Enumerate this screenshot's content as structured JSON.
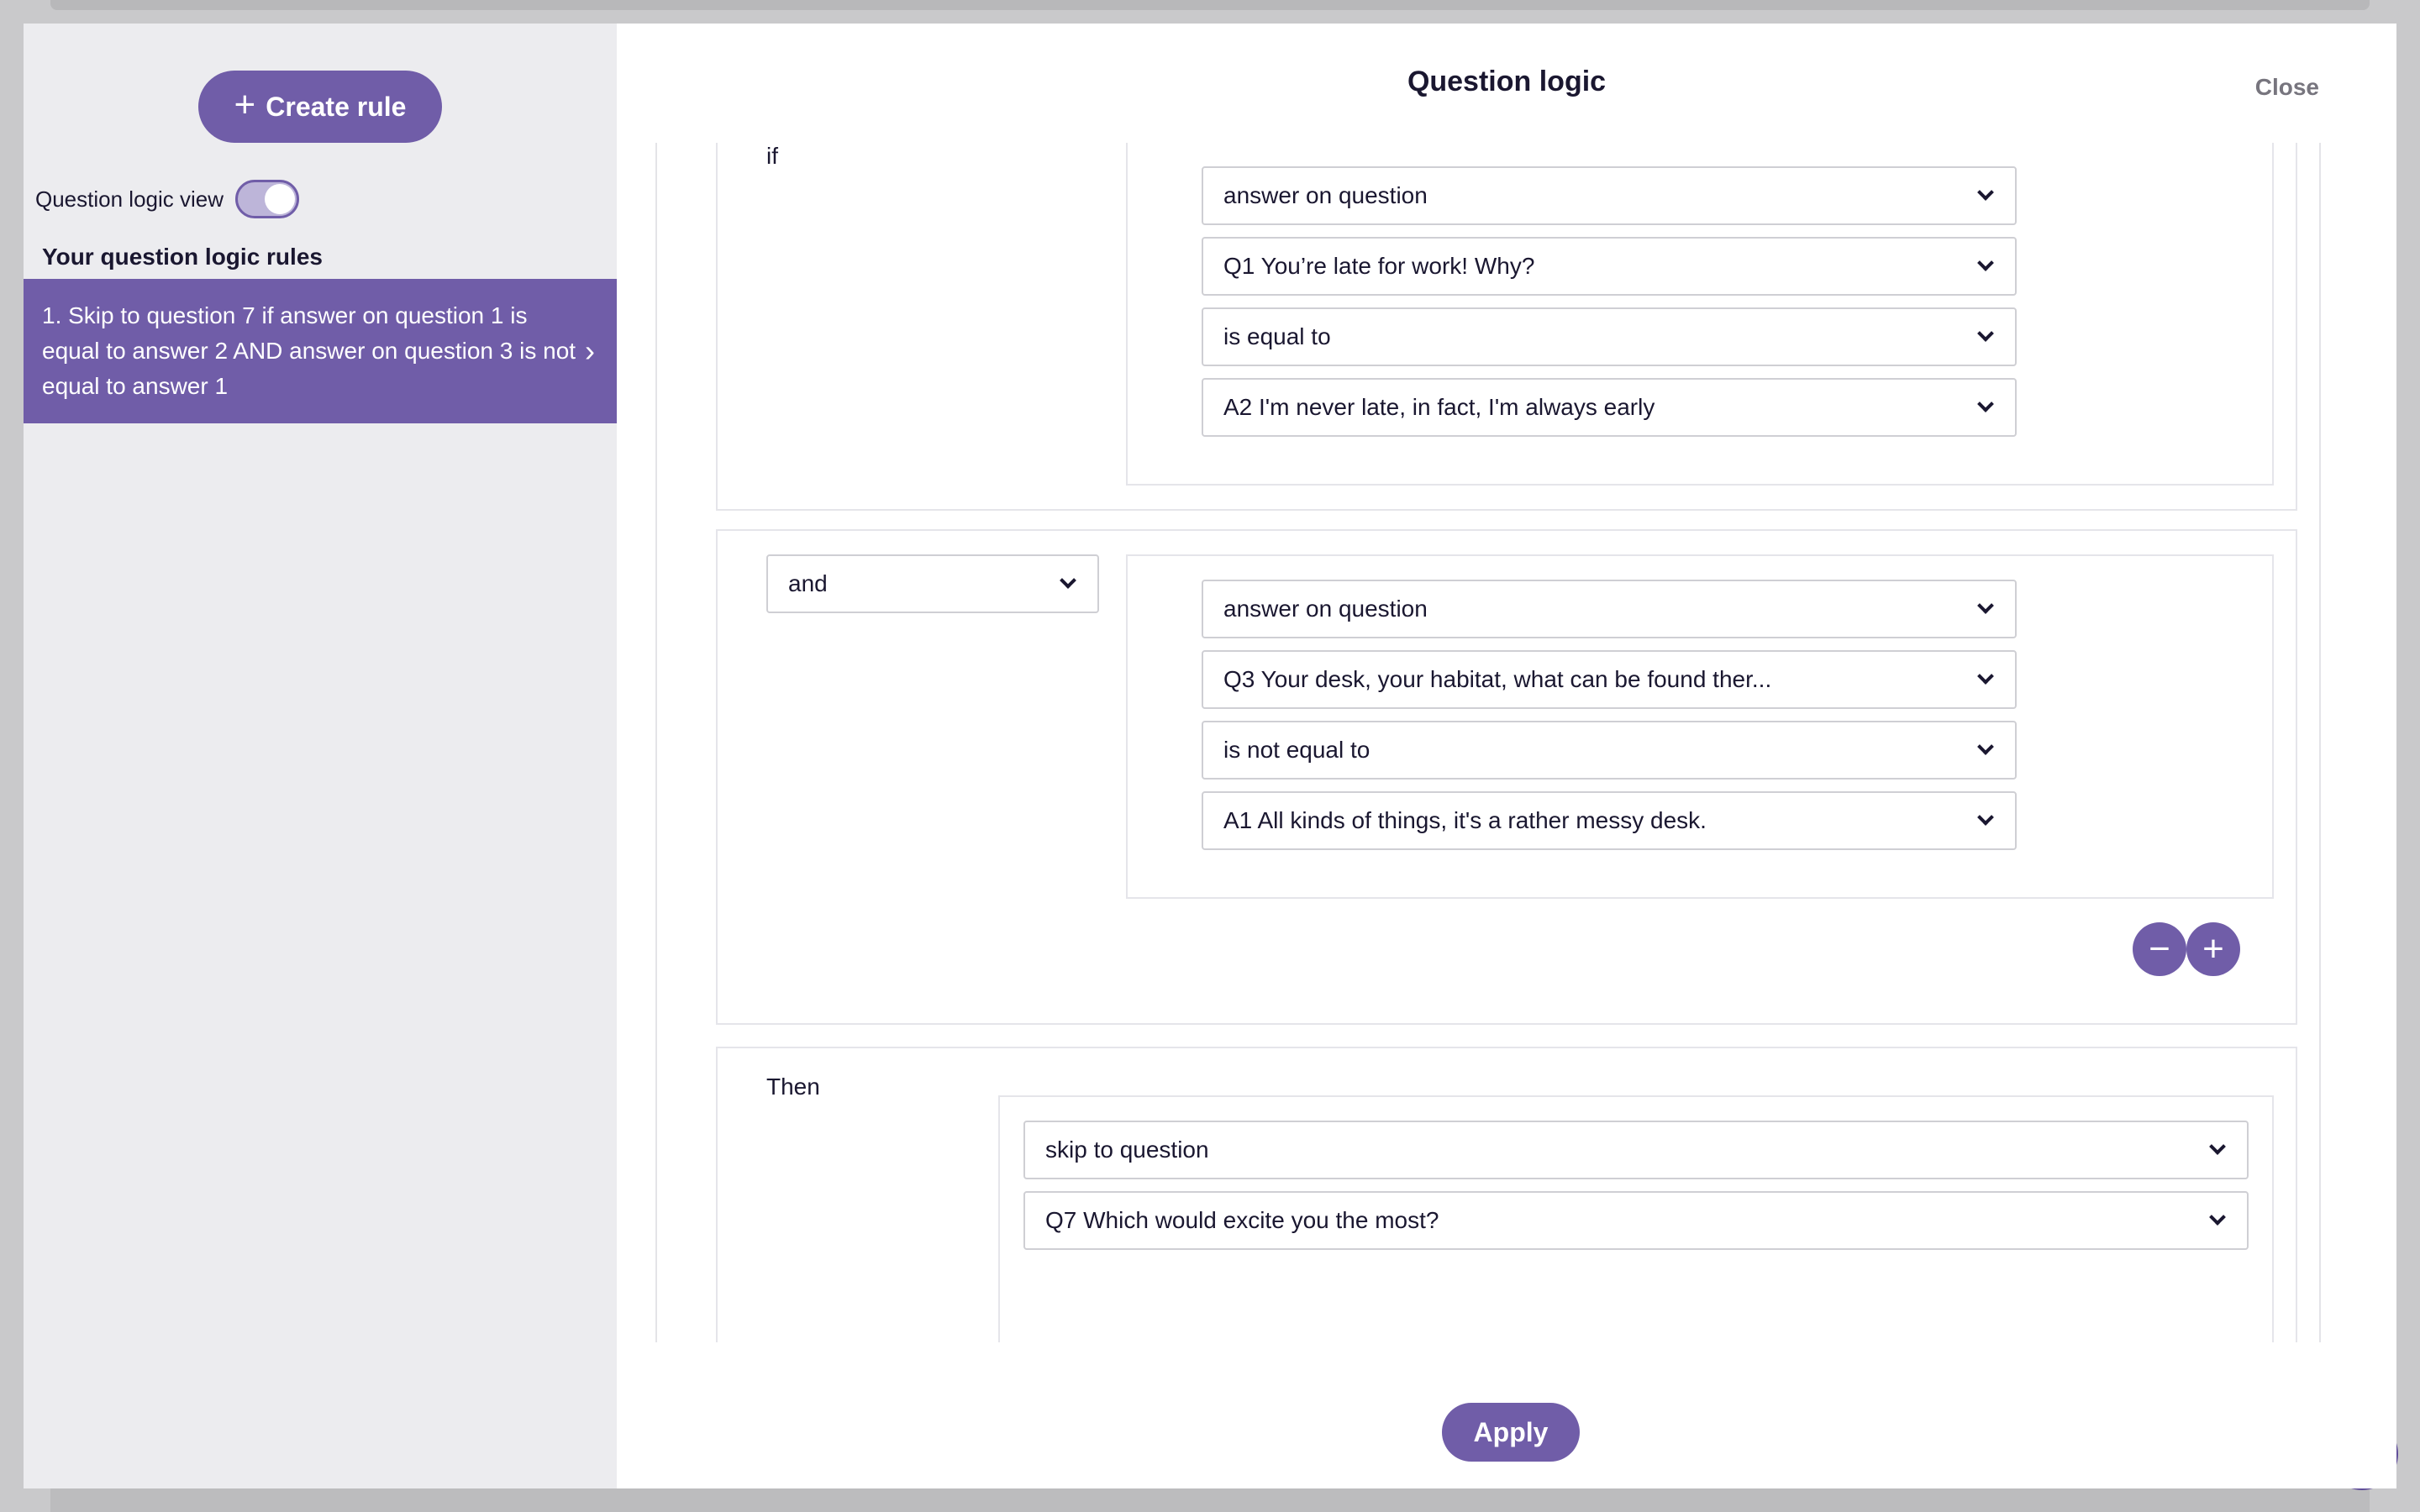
{
  "sidebar": {
    "create_rule_label": "Create rule",
    "logic_view_label": "Question logic view",
    "logic_view_on": true,
    "rules_heading": "Your question logic rules",
    "rules": [
      {
        "text": "1. Skip to question 7 if answer on question 1 is equal to answer 2 AND answer on question 3 is not equal to answer 1"
      }
    ]
  },
  "header": {
    "title": "Question logic",
    "close_label": "Close"
  },
  "condition_if": {
    "keyword": "if",
    "subject": "answer on question",
    "question": "Q1 You’re late for work! Why?",
    "operator": "is equal to",
    "answer": "A2 I'm never late, in fact, I'm always early"
  },
  "condition_and": {
    "connector": "and",
    "subject": "answer on question",
    "question": "Q3 Your desk, your habitat, what can be found ther...",
    "operator": "is not equal to",
    "answer": "A1 All kinds of things, it's a rather messy desk."
  },
  "then": {
    "keyword": "Then",
    "action": "skip to question",
    "target": "Q7 Which would excite you the most?"
  },
  "footer": {
    "apply_label": "Apply"
  },
  "colors": {
    "accent": "#705da8",
    "sidebar_bg": "#ececef",
    "text": "#1a1730"
  }
}
